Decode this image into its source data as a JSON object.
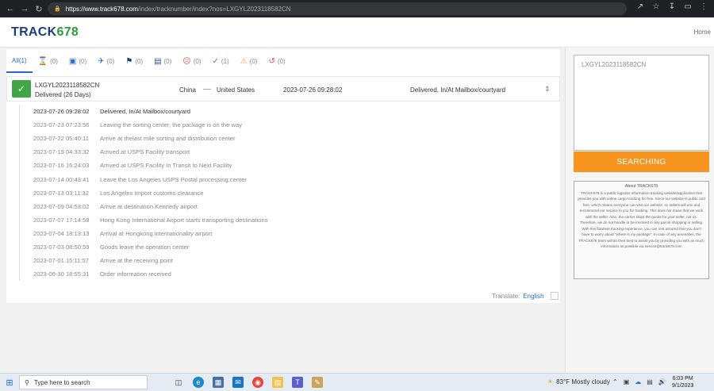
{
  "browser": {
    "url_host": "https://www.track678.com",
    "url_path": "/index/tracknumber/index?nos=LXGYL2023118582CN"
  },
  "site": {
    "logo_part1": "TRACK",
    "logo_part2": "678",
    "home_label": "Home"
  },
  "tabs": [
    {
      "label": "All(1)",
      "icon": "all",
      "active": true
    },
    {
      "label": "(0)",
      "icon": "hourglass-icon"
    },
    {
      "label": "(0)",
      "icon": "package-icon"
    },
    {
      "label": "(0)",
      "icon": "plane-icon"
    },
    {
      "label": "(0)",
      "icon": "flag-icon"
    },
    {
      "label": "(0)",
      "icon": "box-stack-icon"
    },
    {
      "label": "(0)",
      "icon": "sad-face-icon"
    },
    {
      "label": "(1)",
      "icon": "check-icon"
    },
    {
      "label": "(0)",
      "icon": "warning-icon"
    },
    {
      "label": "(0)",
      "icon": "history-icon"
    }
  ],
  "shipment": {
    "tracking_number": "LXGYL2023118582CN",
    "status_days": "Delivered (26 Days)",
    "origin": "China",
    "destination": "United States",
    "latest_time": "2023-07-26 09:28:02",
    "latest_status": "Delivered, In/At Mailbox/courtyard"
  },
  "events": [
    {
      "time": "2023-07-26 09:28:02",
      "desc": "Delivered, In/At Mailbox/courtyard"
    },
    {
      "time": "2023-07-23 07:23:56",
      "desc": "Leaving the sorting center, the package is on the way"
    },
    {
      "time": "2023-07-22 05:40:11",
      "desc": "Arrive at thelast mile sorting and distribution center"
    },
    {
      "time": "2023-07-19 04:33:32",
      "desc": "Arrived at USPS Facility transport"
    },
    {
      "time": "2023-07-16 16:24:03",
      "desc": "Arrived at USPS Facility In Transit to Next Facility"
    },
    {
      "time": "2023-07-14 00:43:41",
      "desc": "Leave the Los Angeles USPS Postal processing,center"
    },
    {
      "time": "2023-07-13 03:11:32",
      "desc": "Los Angeles Import customs clearance"
    },
    {
      "time": "2023-07-09 04:53:02",
      "desc": "Arrive at destination Kennedy airport"
    },
    {
      "time": "2023-07-07 17:14:58",
      "desc": "Hong Kong International Airport starts transporting destinations"
    },
    {
      "time": "2023-07-04 18:13:13",
      "desc": "Arrival at Hongkong internationality airport"
    },
    {
      "time": "2023-07-03 08:50:59",
      "desc": "Goods leave the operation center"
    },
    {
      "time": "2023-07-01 15:11:57",
      "desc": "Arrive at the receiving point"
    },
    {
      "time": "2023-06-30 18:55:31",
      "desc": "Order information received"
    }
  ],
  "translate": {
    "label": "Translate:",
    "language": "English"
  },
  "sidebar": {
    "input_value": "LXGYL2023118582CN",
    "search_label": "SEARCHING",
    "about_title": "About TRACK678",
    "about_text": "TRACK678 is a public logistics information tracking website/application that provides you with online cargo tracking for free. Since our website is public and free, which means everyone can visit our website, so sellers will use and recommend our service to you for tracking. This does not mean that we work with the seller. Also, the carrier ships the goods for your seller, not us. Therefore, we do not handle or be involved in any parcel shopping or selling. With this flawless tracking experience, you can rest assured that you don't have to worry about \"where is my package\". In case of any anomalies, the TRACK678 team will do their best to assist you by providing you with as much information as possible via service@track678.com"
  },
  "taskbar": {
    "search_placeholder": "Type here to search",
    "weather": "83°F  Mostly cloudy",
    "time": "6:03 PM",
    "date": "9/1/2023"
  },
  "colors": {
    "logo_blue": "#1f3d7a",
    "logo_green": "#2e9a3c",
    "accent": "#2d6cc6",
    "delivered_green": "#41a543",
    "search_orange": "#f7941d"
  }
}
